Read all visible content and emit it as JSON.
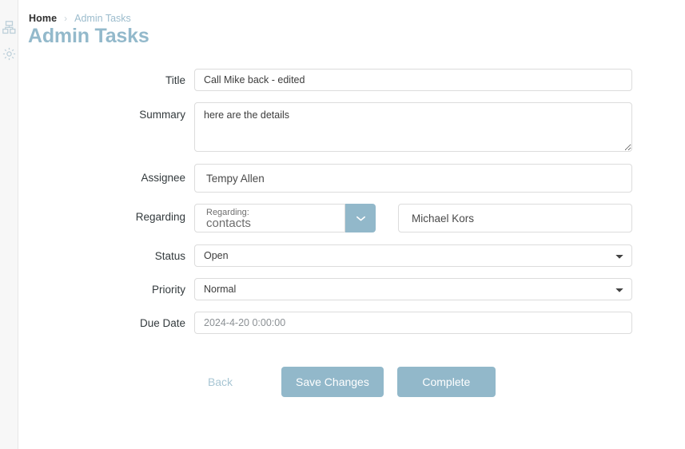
{
  "sidebar": {
    "items": [
      {
        "name": "sitemap-icon",
        "label": "Sitemap"
      },
      {
        "name": "gear-icon",
        "label": "Settings"
      }
    ]
  },
  "header": {
    "breadcrumb": {
      "home": "Home",
      "separator": "›",
      "current": "Admin Tasks"
    },
    "title": "Admin Tasks"
  },
  "form": {
    "title": {
      "label": "Title",
      "value": "Call Mike back - edited"
    },
    "summary": {
      "label": "Summary",
      "value": "here are the details"
    },
    "assignee": {
      "label": "Assignee",
      "value": "Tempy Allen"
    },
    "regarding": {
      "label": "Regarding",
      "type_caption": "Regarding:",
      "type_value": "contacts",
      "dropdown_icon": "chevron-down-icon",
      "target_value": "Michael Kors"
    },
    "status": {
      "label": "Status",
      "value": "Open",
      "options": [
        "Open"
      ]
    },
    "priority": {
      "label": "Priority",
      "value": "Normal",
      "options": [
        "Normal"
      ]
    },
    "due_date": {
      "label": "Due Date",
      "value": "2024-4-20 0:00:00"
    }
  },
  "actions": {
    "back": "Back",
    "save": "Save Changes",
    "complete": "Complete"
  },
  "colors": {
    "accent": "#92b8ca",
    "title": "#93b9cb",
    "sidebar_bg": "#f7f7f7",
    "border": "#dcdcdc",
    "text": "#333a3d"
  }
}
